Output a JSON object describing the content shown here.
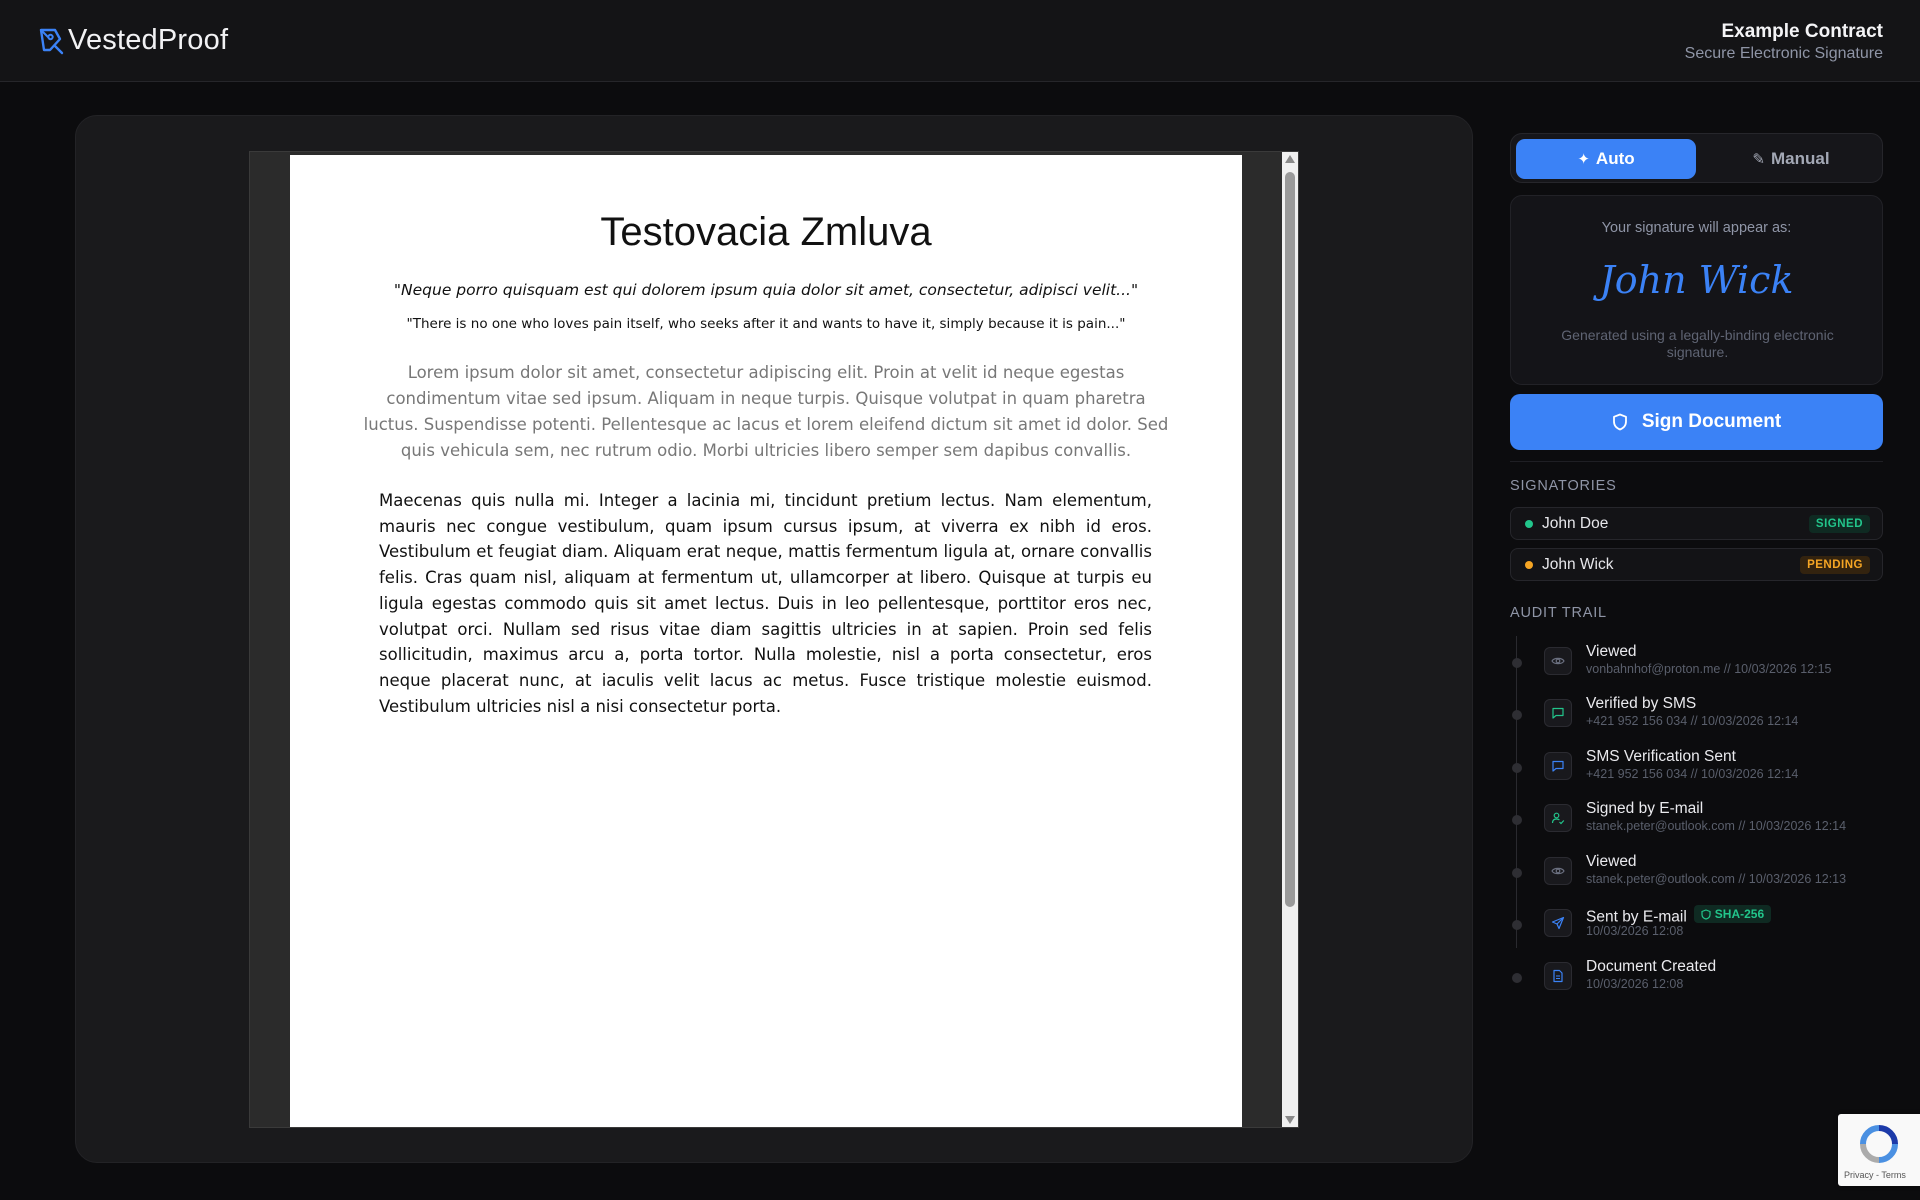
{
  "app": {
    "name": "VestedProof"
  },
  "header": {
    "title": "Example Contract",
    "subtitle": "Secure Electronic Signature"
  },
  "document": {
    "title": "Testovacia Zmluva",
    "quote_latin": "\"Neque porro quisquam est qui dolorem ipsum quia dolor sit amet, consectetur, adipisci velit...\"",
    "quote_english": "\"There is no one who loves pain itself, who seeks after it and wants to have it, simply because it is pain...\"",
    "lorem": "Lorem ipsum dolor sit amet, consectetur adipiscing elit. Proin at velit id neque egestas condimentum vitae sed ipsum. Aliquam in neque turpis. Quisque volutpat in quam pharetra luctus. Suspendisse potenti. Pellentesque ac lacus et lorem eleifend dictum sit amet id dolor. Sed quis vehicula sem, nec rutrum odio. Morbi ultricies libero semper sem dapibus convallis.",
    "body": "Maecenas quis nulla mi. Integer a lacinia mi, tincidunt pretium lectus. Nam elementum, mauris nec congue vestibulum, quam ipsum cursus ipsum, at viverra ex nibh id eros. Vestibulum et feugiat diam. Aliquam erat neque, mattis fermentum ligula at, ornare convallis felis. Cras quam nisl, aliquam at fermentum ut, ullamcorper at libero. Quisque at turpis eu ligula egestas commodo quis sit amet lectus. Duis in leo pellentesque, porttitor eros nec, volutpat orci. Nullam sed risus vitae diam sagittis ultricies in at sapien. Proin sed felis sollicitudin, maximus arcu a, porta tortor. Nulla molestie, nisl a porta consectetur, eros neque placerat nunc, at iaculis velit lacus ac metus. Fusce tristique molestie euismod. Vestibulum ultricies nisl a nisi consectetur porta."
  },
  "signature_mode": {
    "auto_label": "Auto",
    "manual_label": "Manual",
    "selected": "Auto"
  },
  "signature_preview": {
    "label": "Your signature will appear as:",
    "name": "John Wick",
    "note": "Generated using a legally-binding electronic signature."
  },
  "sign_button": {
    "label": "Sign Document"
  },
  "signatories": {
    "heading": "SIGNATORIES",
    "items": [
      {
        "name": "John Doe",
        "status": "SIGNED",
        "color": "#22c58b"
      },
      {
        "name": "John Wick",
        "status": "PENDING",
        "color": "#f5a524"
      }
    ]
  },
  "audit_trail": {
    "heading": "AUDIT TRAIL",
    "items": [
      {
        "title": "Viewed",
        "subtitle": "vonbahnhof@proton.me // 10/03/2026 12:15",
        "icon": "eye-icon"
      },
      {
        "title": "Verified by SMS",
        "subtitle": "+421 952 156 034 // 10/03/2026 12:14",
        "icon": "message-icon"
      },
      {
        "title": "SMS Verification Sent",
        "subtitle": "+421 952 156 034 // 10/03/2026 12:14",
        "icon": "message-icon"
      },
      {
        "title": "Signed by E-mail",
        "subtitle": "stanek.peter@outlook.com // 10/03/2026 12:14",
        "icon": "user-check-icon"
      },
      {
        "title": "Viewed",
        "subtitle": "stanek.peter@outlook.com // 10/03/2026 12:13",
        "icon": "eye-icon"
      },
      {
        "title": "Sent by E-mail",
        "subtitle": "10/03/2026 12:08",
        "icon": "send-icon",
        "badge": "SHA-256"
      },
      {
        "title": "Document Created",
        "subtitle": "10/03/2026 12:08",
        "icon": "file-icon"
      }
    ]
  },
  "recaptcha": {
    "links": "Privacy - Terms"
  },
  "colors": {
    "accent": "#3b82f6",
    "signed": "#22c58b",
    "pending": "#f5a524",
    "background": "#0c0c0e"
  }
}
